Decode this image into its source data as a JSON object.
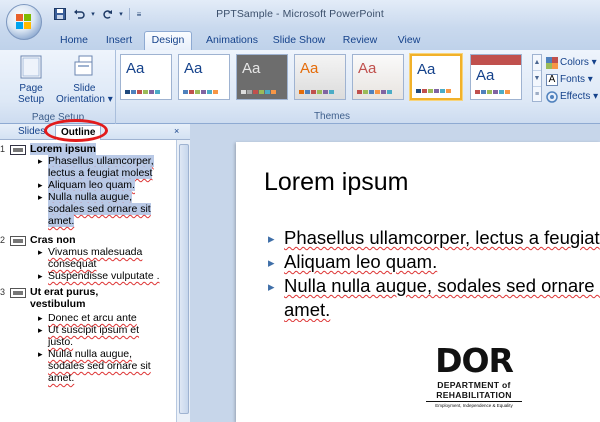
{
  "window": {
    "title": "PPTSample - Microsoft PowerPoint"
  },
  "quick_access": {
    "save_icon": "save-icon",
    "undo_icon": "undo-icon",
    "redo_icon": "redo-icon",
    "customize_icon": "customize-icon"
  },
  "tabs": [
    {
      "label": "Home"
    },
    {
      "label": "Insert"
    },
    {
      "label": "Design",
      "active": true
    },
    {
      "label": "Animations"
    },
    {
      "label": "Slide Show"
    },
    {
      "label": "Review"
    },
    {
      "label": "View"
    }
  ],
  "ribbon": {
    "page_setup": {
      "setup_label_1": "Page",
      "setup_label_2": "Setup",
      "orient_label_1": "Slide",
      "orient_label_2": "Orientation ▾",
      "group_label": "Page Setup"
    },
    "themes": {
      "group_label": "Themes",
      "sample": "Aa"
    },
    "right": {
      "colors": "Colors ▾",
      "fonts": "Fonts ▾",
      "effects": "Effects ▾"
    }
  },
  "left_pane": {
    "tabs": [
      {
        "label": "Slides"
      },
      {
        "label": "Outline",
        "active": true
      }
    ],
    "close": "×",
    "slides": [
      {
        "num": "1",
        "title": "Lorem ipsum",
        "bullets": [
          "Phasellus ullamcorper, lectus a feugiat molest",
          "Aliquam leo quam.",
          "Nulla nulla augue, sodales sed ornare sit amet."
        ]
      },
      {
        "num": "2",
        "title": "Cras non",
        "bullets": [
          "Vivamus malesuada consequat",
          "Suspendisse vulputate ."
        ]
      },
      {
        "num": "3",
        "title": "Ut erat purus, vestibulum",
        "bullets": [
          "Donec et arcu ante",
          "Ut suscipit ipsum et justo.",
          "Nulla nulla augue, sodales sed ornare sit amet."
        ]
      }
    ]
  },
  "slide": {
    "title": "Lorem ipsum",
    "bullets": [
      "Phasellus ullamcorper, lectus a feugiat",
      "Aliquam leo quam.",
      "Nulla nulla augue, sodales sed ornare sit",
      "amet."
    ],
    "logo": {
      "word": "DOR",
      "line1": "DEPARTMENT of",
      "line2": "REHABILITATION",
      "tagline": "Employment, Independence & Equality"
    }
  },
  "colors": {
    "accent_ring": "#e21b1b",
    "theme_selected_border": "#f1b12a",
    "ribbon_text": "#15428b"
  }
}
